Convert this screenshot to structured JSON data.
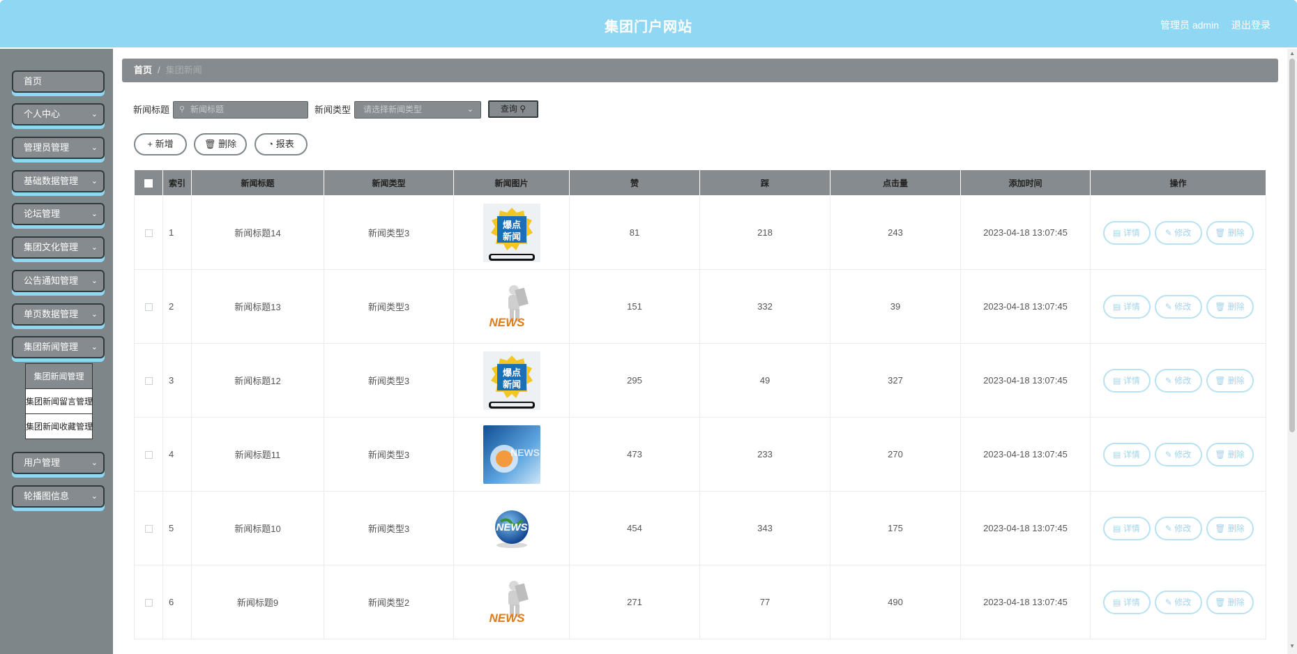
{
  "header": {
    "title": "集团门户网站",
    "user": "管理员 admin",
    "logout": "退出登录"
  },
  "sidebar": {
    "items": [
      {
        "label": "首页",
        "has_children": false
      },
      {
        "label": "个人中心",
        "has_children": true
      },
      {
        "label": "管理员管理",
        "has_children": true
      },
      {
        "label": "基础数据管理",
        "has_children": true
      },
      {
        "label": "论坛管理",
        "has_children": true
      },
      {
        "label": "集团文化管理",
        "has_children": true
      },
      {
        "label": "公告通知管理",
        "has_children": true
      },
      {
        "label": "单页数据管理",
        "has_children": true
      },
      {
        "label": "集团新闻管理",
        "has_children": true
      },
      {
        "label": "用户管理",
        "has_children": true
      },
      {
        "label": "轮播图信息",
        "has_children": true
      }
    ],
    "submenu": [
      "集团新闻管理",
      "集团新闻留言管理",
      "集团新闻收藏管理"
    ]
  },
  "breadcrumb": {
    "home": "首页",
    "separator": "/",
    "current": "集团新闻"
  },
  "search": {
    "title_label": "新闻标题",
    "title_placeholder": "新闻标题",
    "type_label": "新闻类型",
    "type_placeholder": "请选择新闻类型",
    "query_label": "查询"
  },
  "actions": {
    "add": "新增",
    "delete": "删除",
    "report": "报表"
  },
  "table": {
    "headers": [
      "索引",
      "新闻标题",
      "新闻类型",
      "新闻图片",
      "赞",
      "踩",
      "点击量",
      "添加时间",
      "操作"
    ],
    "op_labels": {
      "detail": "详情",
      "edit": "修改",
      "delete": "删除"
    },
    "rows": [
      {
        "index": "1",
        "title": "新闻标题14",
        "type": "新闻类型3",
        "image": "burst-news",
        "likes": "81",
        "dislikes": "218",
        "clicks": "243",
        "time": "2023-04-18 13:07:45"
      },
      {
        "index": "2",
        "title": "新闻标题13",
        "type": "新闻类型3",
        "image": "figure-news",
        "likes": "151",
        "dislikes": "332",
        "clicks": "39",
        "time": "2023-04-18 13:07:45"
      },
      {
        "index": "3",
        "title": "新闻标题12",
        "type": "新闻类型3",
        "image": "burst-news",
        "likes": "295",
        "dislikes": "49",
        "clicks": "327",
        "time": "2023-04-18 13:07:45"
      },
      {
        "index": "4",
        "title": "新闻标题11",
        "type": "新闻类型3",
        "image": "blue-news",
        "likes": "473",
        "dislikes": "233",
        "clicks": "270",
        "time": "2023-04-18 13:07:45"
      },
      {
        "index": "5",
        "title": "新闻标题10",
        "type": "新闻类型3",
        "image": "globe-news",
        "likes": "454",
        "dislikes": "343",
        "clicks": "175",
        "time": "2023-04-18 13:07:45"
      },
      {
        "index": "6",
        "title": "新闻标题9",
        "type": "新闻类型2",
        "image": "figure-news",
        "likes": "271",
        "dislikes": "77",
        "clicks": "490",
        "time": "2023-04-18 13:07:45"
      }
    ]
  },
  "images": {
    "burst_text_1": "爆点",
    "burst_text_2": "新闻",
    "news_word": "NEWS"
  },
  "colors": {
    "header": "#8fd7f2",
    "sidebar": "#7d8689",
    "accent": "#858b8e",
    "op_border": "#b8e1f2"
  }
}
